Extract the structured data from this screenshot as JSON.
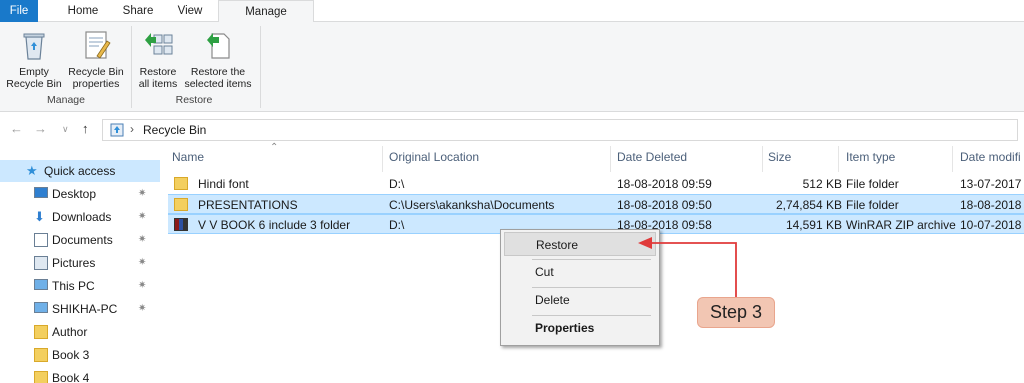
{
  "tabs": {
    "file": "File",
    "home": "Home",
    "share": "Share",
    "view": "View",
    "manage": "Manage"
  },
  "ribbon": {
    "empty_line1": "Empty",
    "empty_line2": "Recycle Bin",
    "props_line1": "Recycle Bin",
    "props_line2": "properties",
    "manage_group": "Manage",
    "restore_all_line1": "Restore",
    "restore_all_line2": "all items",
    "restore_sel_line1": "Restore the",
    "restore_sel_line2": "selected items",
    "restore_group": "Restore"
  },
  "address": {
    "separator": "›",
    "location": "Recycle Bin"
  },
  "nav": {
    "items": [
      {
        "label": "Quick access",
        "icon": "star-icon"
      },
      {
        "label": "Desktop",
        "icon": "desktop-icon",
        "pinned": true
      },
      {
        "label": "Downloads",
        "icon": "download-icon",
        "pinned": true
      },
      {
        "label": "Documents",
        "icon": "document-icon",
        "pinned": true
      },
      {
        "label": "Pictures",
        "icon": "pictures-icon",
        "pinned": true
      },
      {
        "label": "This PC",
        "icon": "computer-icon",
        "pinned": true
      },
      {
        "label": "SHIKHA-PC",
        "icon": "computer-icon",
        "pinned": true
      },
      {
        "label": "Author",
        "icon": "folder-icon"
      },
      {
        "label": "Book 3",
        "icon": "folder-icon"
      },
      {
        "label": "Book 4",
        "icon": "folder-icon"
      }
    ]
  },
  "columns": {
    "name": "Name",
    "original_location": "Original Location",
    "date_deleted": "Date Deleted",
    "size": "Size",
    "item_type": "Item type",
    "date_modified": "Date modifi"
  },
  "files": [
    {
      "name": "Hindi font",
      "location": "D:\\",
      "deleted": "18-08-2018 09:59",
      "size": "512 KB",
      "type": "File folder",
      "modified": "13-07-2017 1",
      "icon": "folder-icon"
    },
    {
      "name": "PRESENTATIONS",
      "location": "C:\\Users\\akanksha\\Documents",
      "deleted": "18-08-2018 09:50",
      "size": "2,74,854 KB",
      "type": "File folder",
      "modified": "18-08-2018 (",
      "icon": "folder-icon"
    },
    {
      "name": "V V BOOK 6 include 3 folder",
      "location": "D:\\",
      "deleted": "18-08-2018 09:58",
      "size": "14,591 KB",
      "type": "WinRAR ZIP archive",
      "modified": "10-07-2018 1",
      "icon": "archive-icon"
    }
  ],
  "context_menu": {
    "restore": "Restore",
    "cut": "Cut",
    "delete": "Delete",
    "properties": "Properties"
  },
  "annotation": {
    "label": "Step 3",
    "color": "#e03a3a"
  }
}
